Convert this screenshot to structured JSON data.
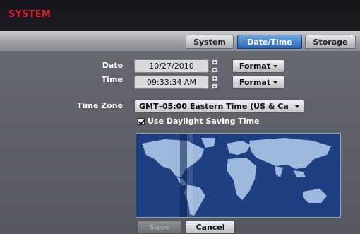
{
  "window": {
    "title": "SYSTEM"
  },
  "tabs": [
    {
      "label": "System",
      "active": false
    },
    {
      "label": "Date/Time",
      "active": true
    },
    {
      "label": "Storage",
      "active": false
    }
  ],
  "date": {
    "label": "Date",
    "value": "10/27/2010",
    "format_label": "Format"
  },
  "time": {
    "label": "Time",
    "value": "09:33:34 AM",
    "format_label": "Format"
  },
  "timezone": {
    "label": "Time Zone",
    "value": "GMT–05:00  Eastern Time (US & Ca"
  },
  "dst": {
    "label": "Use Daylight Saving Time",
    "checked": true
  },
  "map": {
    "icon": "world-map"
  },
  "footer": {
    "save_label": "Save",
    "save_enabled": false,
    "cancel_label": "Cancel"
  },
  "colors": {
    "accent": "#2c66b3",
    "title": "#d8242c",
    "map_ocean": "#1f3f83",
    "map_land": "#9fb8dd"
  }
}
